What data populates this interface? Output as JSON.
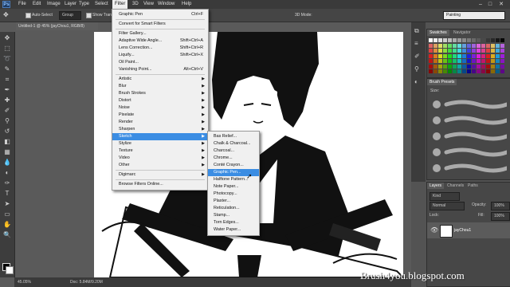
{
  "app": {
    "logo": "Ps"
  },
  "menubar": {
    "items": [
      "File",
      "Edit",
      "Image",
      "Layer",
      "Type",
      "Select",
      "Filter",
      "3D",
      "View",
      "Window",
      "Help"
    ],
    "active": "Filter",
    "controls": {
      "minimize": "–",
      "maximize": "□",
      "close": "✕"
    }
  },
  "options": {
    "auto_select": "Auto-Select",
    "group": "Group",
    "show_transform": "Show Trans",
    "mode_3d": "3D Mode:",
    "workspace": "Painting"
  },
  "document": {
    "tab_title": "Untitled-1 @ 45% (jayChou1, RGB/8)"
  },
  "status": {
    "zoom": "45.05%",
    "doc": "Doc: 5.84M/9.20M"
  },
  "filter_menu": {
    "items": [
      {
        "label": "Graphic Pen",
        "shortcut": "Ctrl+F"
      },
      {
        "sep": true
      },
      {
        "label": "Convert for Smart Filters"
      },
      {
        "sep": true
      },
      {
        "label": "Filter Gallery..."
      },
      {
        "label": "Adaptive Wide Angle...",
        "shortcut": "Shift+Ctrl+A"
      },
      {
        "label": "Lens Correction...",
        "shortcut": "Shift+Ctrl+R"
      },
      {
        "label": "Liquify...",
        "shortcut": "Shift+Ctrl+X"
      },
      {
        "label": "Oil Paint..."
      },
      {
        "label": "Vanishing Point...",
        "shortcut": "Alt+Ctrl+V"
      },
      {
        "sep": true
      },
      {
        "label": "Artistic",
        "sub": true
      },
      {
        "label": "Blur",
        "sub": true
      },
      {
        "label": "Brush Strokes",
        "sub": true
      },
      {
        "label": "Distort",
        "sub": true
      },
      {
        "label": "Noise",
        "sub": true
      },
      {
        "label": "Pixelate",
        "sub": true
      },
      {
        "label": "Render",
        "sub": true
      },
      {
        "label": "Sharpen",
        "sub": true
      },
      {
        "label": "Sketch",
        "sub": true,
        "highlight": true
      },
      {
        "label": "Stylize",
        "sub": true
      },
      {
        "label": "Texture",
        "sub": true
      },
      {
        "label": "Video",
        "sub": true
      },
      {
        "label": "Other",
        "sub": true
      },
      {
        "sep": true
      },
      {
        "label": "Digimarc",
        "sub": true
      },
      {
        "sep": true
      },
      {
        "label": "Browse Filters Online..."
      }
    ]
  },
  "sketch_menu": {
    "items": [
      {
        "label": "Bas Relief..."
      },
      {
        "label": "Chalk & Charcoal..."
      },
      {
        "label": "Charcoal..."
      },
      {
        "label": "Chrome..."
      },
      {
        "label": "Conté Crayon..."
      },
      {
        "label": "Graphic Pen...",
        "highlight": true
      },
      {
        "label": "Halftone Pattern..."
      },
      {
        "label": "Note Paper..."
      },
      {
        "label": "Photocopy..."
      },
      {
        "label": "Plaster..."
      },
      {
        "label": "Reticulation..."
      },
      {
        "label": "Stamp..."
      },
      {
        "label": "Torn Edges..."
      },
      {
        "label": "Water Paper..."
      }
    ]
  },
  "panels": {
    "swatches_tabs": [
      "Swatches",
      "Navigator"
    ],
    "brush_presets": "Brush Presets",
    "size_label": "Size:",
    "layers_tabs": [
      "Layers",
      "Channels",
      "Paths"
    ],
    "kind": "Kind",
    "blend_mode": "Normal",
    "opacity_label": "Opacity:",
    "opacity": "100%",
    "lock_label": "Lock:",
    "fill_label": "Fill:",
    "fill": "100%",
    "layer_name": "jayChou1"
  },
  "watermark": "Brush4you.blogspot.com"
}
